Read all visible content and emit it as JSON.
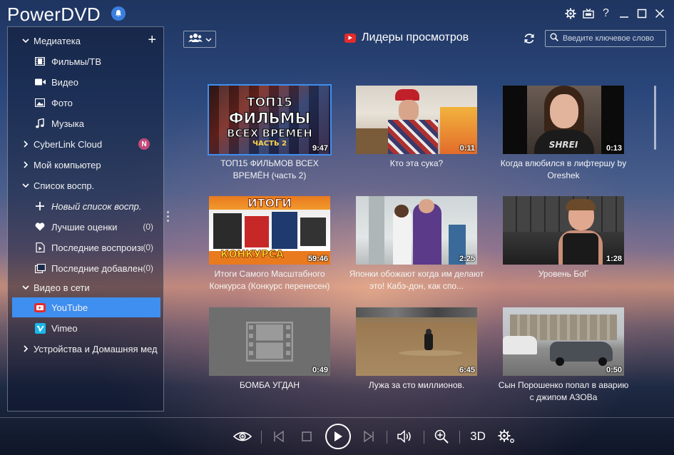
{
  "app": {
    "title": "PowerDVD"
  },
  "window_controls": [
    "gear-icon",
    "tv-icon",
    "help-icon",
    "minimize-icon",
    "maximize-icon",
    "close-icon"
  ],
  "window_control_labels": {
    "help": "?"
  },
  "sidebar": {
    "library": {
      "label": "Медиатека",
      "add": "+"
    },
    "library_items": [
      {
        "label": "Фильмы/ТВ",
        "icon": "film-icon"
      },
      {
        "label": "Видео",
        "icon": "video-camera-icon"
      },
      {
        "label": "Фото",
        "icon": "photo-icon"
      },
      {
        "label": "Музыка",
        "icon": "music-icon"
      }
    ],
    "cyberlink_cloud": {
      "label": "CyberLink Cloud",
      "badge": "N"
    },
    "my_computer": {
      "label": "Мой компьютер"
    },
    "playlists": {
      "label": "Список воспр."
    },
    "playlist_items": [
      {
        "label": "Новый список воспр.",
        "icon": "plus-icon",
        "count": ""
      },
      {
        "label": "Лучшие оценки",
        "icon": "heart-icon",
        "count": "(0)"
      },
      {
        "label": "Последние воспроизв",
        "icon": "recent-played-icon",
        "count": "(0)"
      },
      {
        "label": "Последние добавлен",
        "icon": "recent-added-icon",
        "count": "(0)"
      }
    ],
    "online_video": {
      "label": "Видео в сети"
    },
    "online_items": [
      {
        "label": "YouTube",
        "icon": "youtube-icon"
      },
      {
        "label": "Vimeo",
        "icon": "vimeo-icon"
      }
    ],
    "devices": {
      "label": "Устройства и Домашняя мед"
    }
  },
  "toolbar": {
    "section_title": "Лидеры просмотров",
    "search_placeholder": "Введите ключевое слово"
  },
  "videos": [
    {
      "title": "ТОП15 ФИЛЬМОВ ВСЕХ ВРЕМЁН (часть 2)",
      "duration": "9:47",
      "thumb_text": [
        "ТОП15",
        "ФИЛЬМЫ",
        "ВСЕХ ВРЕМЕН",
        "ЧАСТЬ 2"
      ]
    },
    {
      "title": "Кто эта сука?",
      "duration": "0:11"
    },
    {
      "title": "Когда влюбился в лифтершу by Oreshek",
      "duration": "0:13",
      "thumb_text": [
        "SHREI"
      ]
    },
    {
      "title": "Итоги Самого Масштабного Конкурса (Конкурс перенесен)",
      "duration": "59:46",
      "thumb_text": [
        "ИТОГИ",
        "КОНКУРСА"
      ]
    },
    {
      "title": "Японки обожают когда им делают это! Кабэ-дон, как спо...",
      "duration": "2:25"
    },
    {
      "title": "Уровень БоГ",
      "duration": "1:28"
    },
    {
      "title": "БОМБА УГДАН",
      "duration": "0:49"
    },
    {
      "title": "Лужа за сто миллионов.",
      "duration": "6:45"
    },
    {
      "title": "Сын Порошенко попал в аварию с джипом АЗОВа",
      "duration": "0:50"
    }
  ],
  "player": {
    "buttons": [
      "eye-icon",
      "previous-icon",
      "stop-icon",
      "play-icon",
      "next-icon",
      "volume-icon",
      "zoom-icon",
      "3d-button",
      "settings-icon"
    ],
    "label_3d": "3D"
  },
  "colors": {
    "accent": "#3f8ff0",
    "youtube_red": "#e32b2b",
    "vimeo": "#1ab7ea",
    "badge": "#c24a78"
  }
}
